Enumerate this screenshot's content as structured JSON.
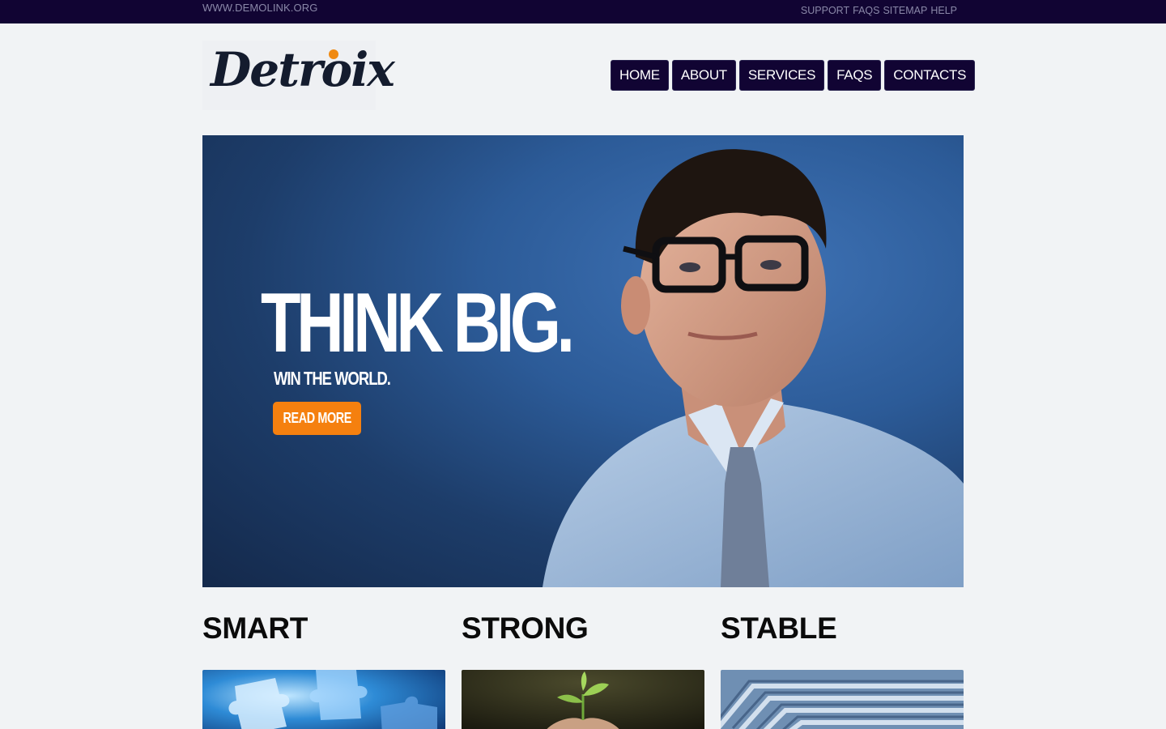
{
  "topbar": {
    "site_url": "WWW.DEMOLINK.ORG",
    "links": [
      "SUPPORT",
      "FAQS",
      "SITEMAP",
      "HELP"
    ]
  },
  "logo": {
    "text": "Detroix",
    "dot_color": "#f08a12"
  },
  "nav": {
    "items": [
      "HOME",
      "ABOUT",
      "SERVICES",
      "FAQS",
      "CONTACTS"
    ],
    "background": "#110433"
  },
  "hero": {
    "headline": "THINK BIG.",
    "tagline": "WIN THE WORLD.",
    "cta_label": "READ MORE",
    "cta_color": "#f5800f"
  },
  "features": [
    {
      "title": "SMART",
      "image_icon": "puzzle-image"
    },
    {
      "title": "STRONG",
      "image_icon": "sprout-image"
    },
    {
      "title": "STABLE",
      "image_icon": "maze-image"
    }
  ]
}
